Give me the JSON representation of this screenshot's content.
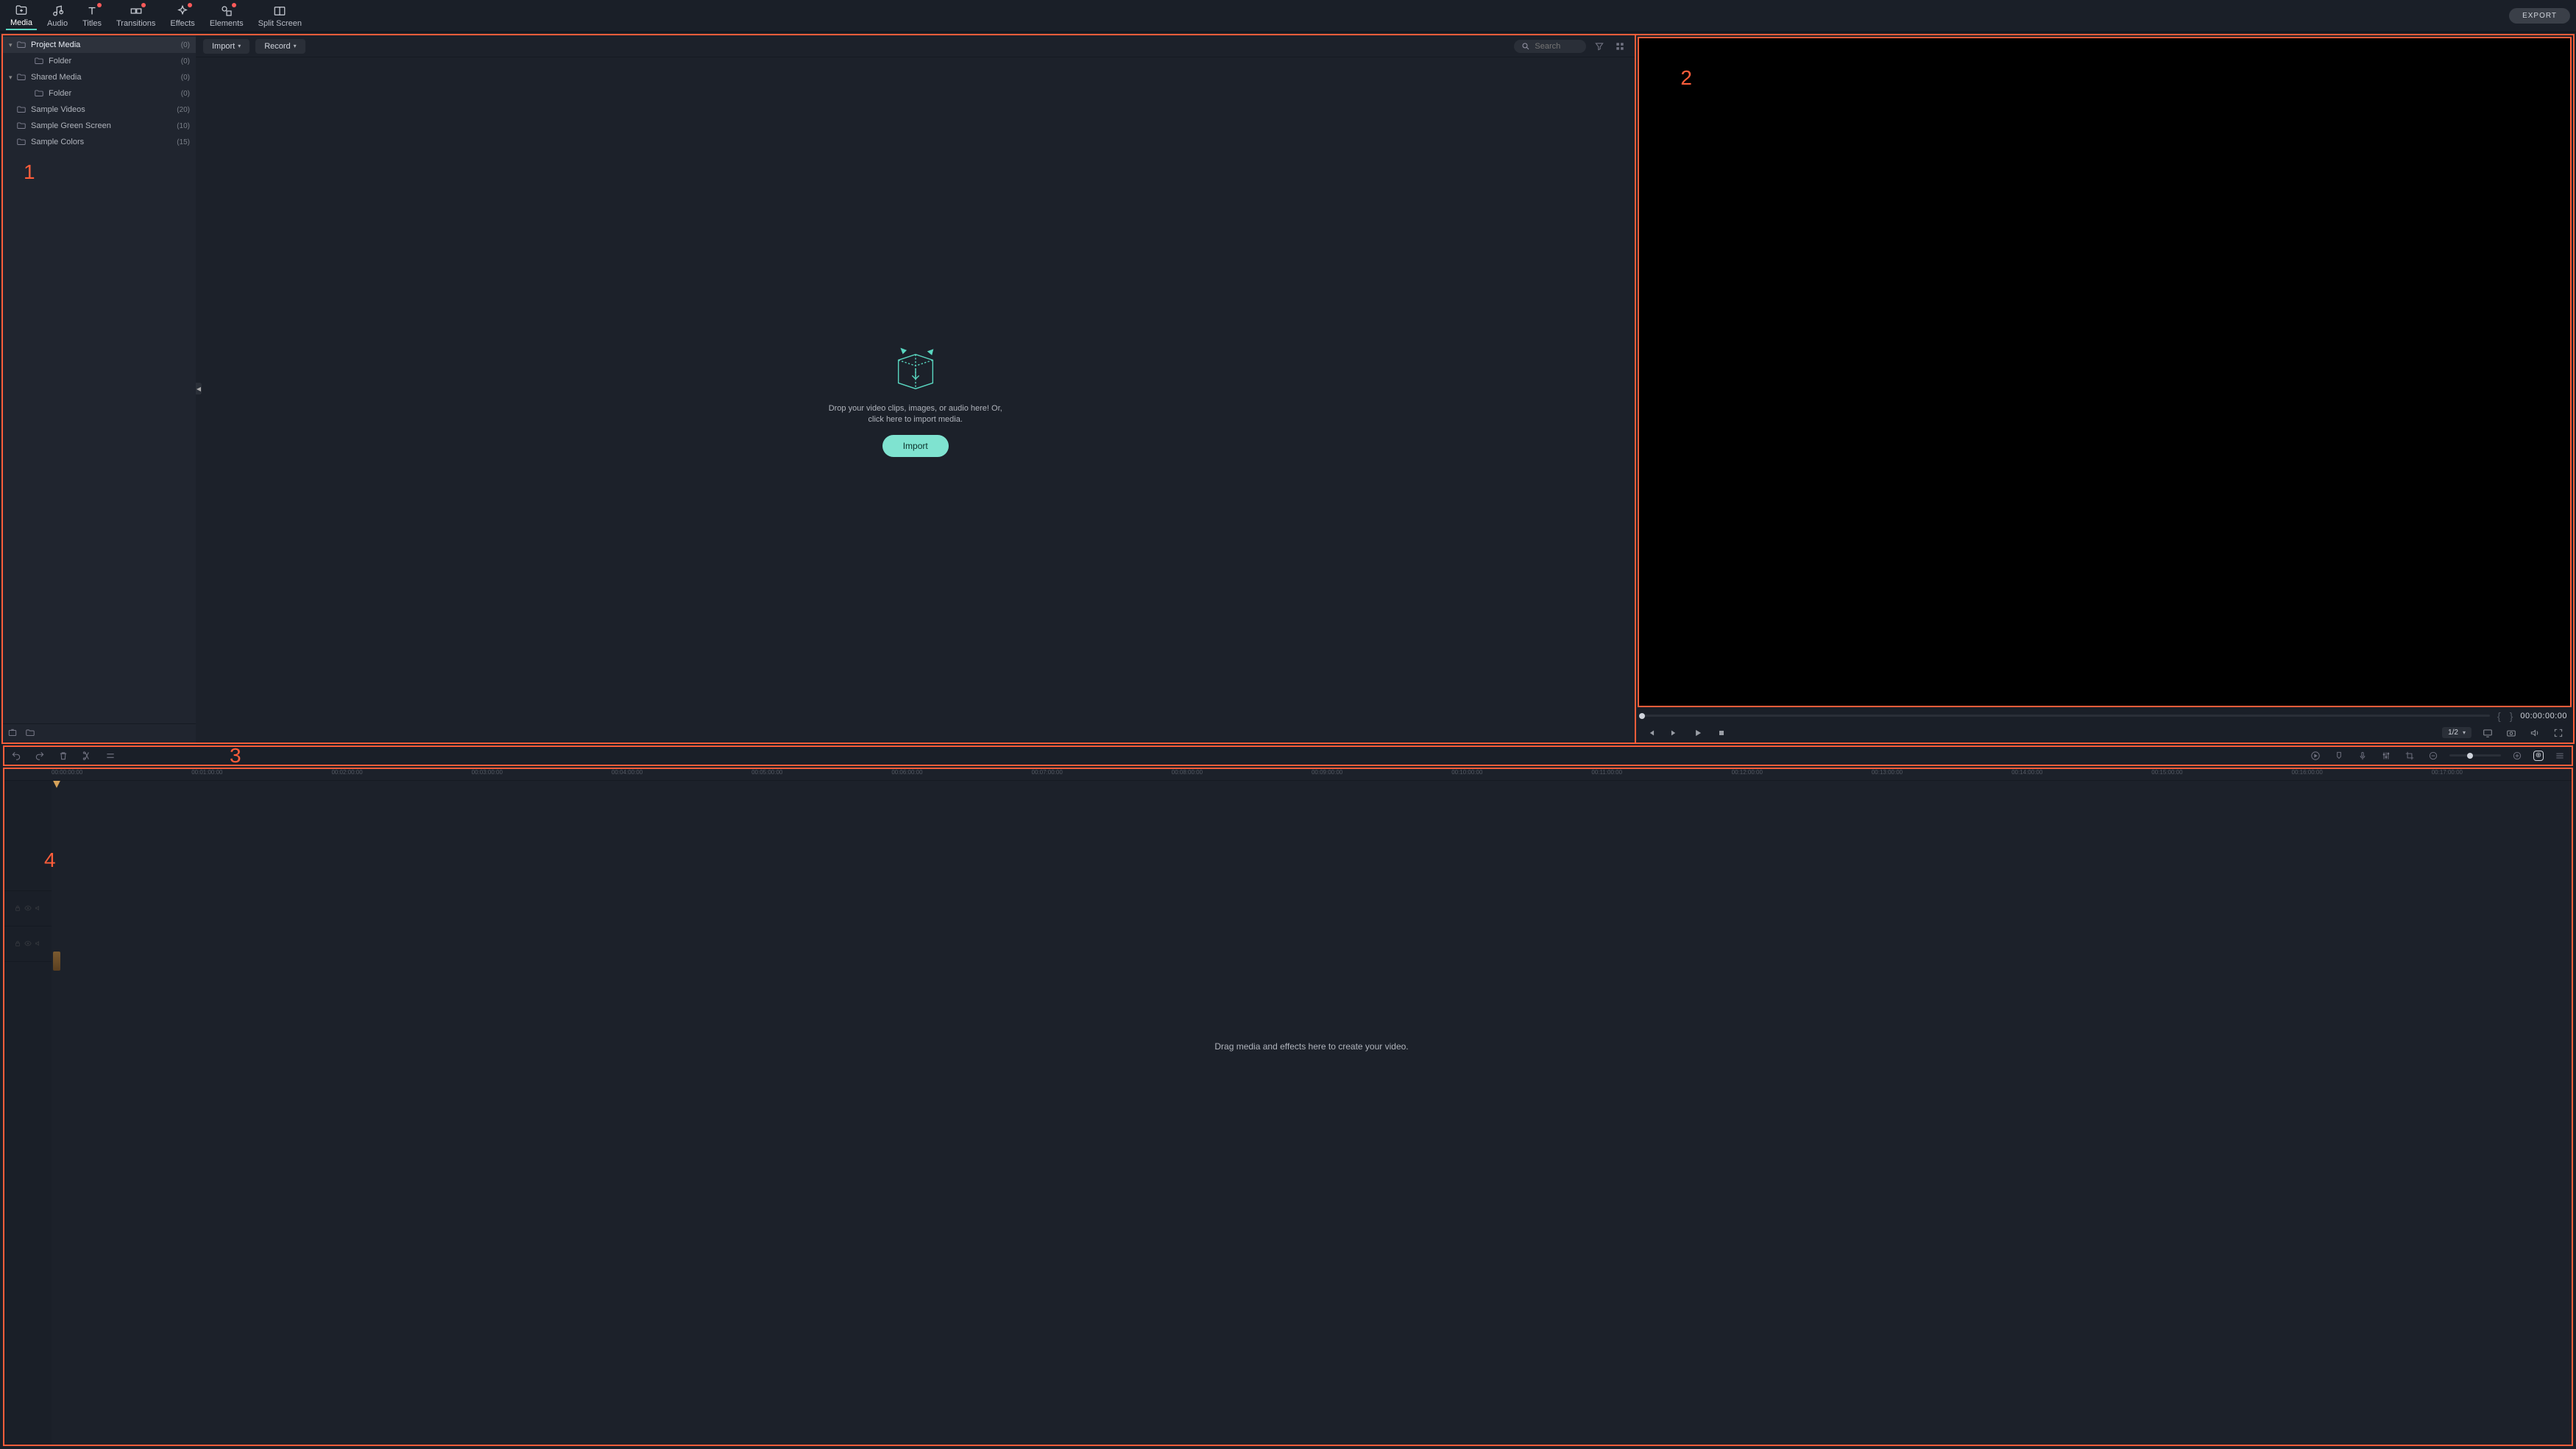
{
  "tabs": [
    {
      "label": "Media",
      "active": true,
      "badge": false
    },
    {
      "label": "Audio",
      "active": false,
      "badge": false
    },
    {
      "label": "Titles",
      "active": false,
      "badge": true
    },
    {
      "label": "Transitions",
      "active": false,
      "badge": true
    },
    {
      "label": "Effects",
      "active": false,
      "badge": true
    },
    {
      "label": "Elements",
      "active": false,
      "badge": true
    },
    {
      "label": "Split Screen",
      "active": false,
      "badge": false
    }
  ],
  "export_label": "EXPORT",
  "sidebar": {
    "tree": [
      {
        "label": "Project Media",
        "count": "(0)",
        "indent": 0,
        "arrow": "▾",
        "selected": true
      },
      {
        "label": "Folder",
        "count": "(0)",
        "indent": 1,
        "arrow": "",
        "selected": false
      },
      {
        "label": "Shared Media",
        "count": "(0)",
        "indent": 0,
        "arrow": "▾",
        "selected": false
      },
      {
        "label": "Folder",
        "count": "(0)",
        "indent": 1,
        "arrow": "",
        "selected": false
      },
      {
        "label": "Sample Videos",
        "count": "(20)",
        "indent": 0,
        "arrow": "",
        "selected": false
      },
      {
        "label": "Sample Green Screen",
        "count": "(10)",
        "indent": 0,
        "arrow": "",
        "selected": false
      },
      {
        "label": "Sample Colors",
        "count": "(15)",
        "indent": 0,
        "arrow": "",
        "selected": false
      }
    ]
  },
  "media_toolbar": {
    "import_label": "Import",
    "record_label": "Record",
    "search_placeholder": "Search"
  },
  "drop_zone": {
    "text": "Drop your video clips, images, or audio here! Or, click here to import media.",
    "button": "Import"
  },
  "preview": {
    "zoom": "1/2",
    "timecode": "00:00:00:00"
  },
  "timeline": {
    "hint": "Drag media and effects here to create your video.",
    "ruler": [
      "00:00:00:00",
      "00:01:00:00",
      "00:02:00:00",
      "00:03:00:00",
      "00:04:00:00",
      "00:05:00:00",
      "00:06:00:00",
      "00:07:00:00",
      "00:08:00:00",
      "00:09:00:00",
      "00:10:00:00",
      "00:11:00:00",
      "00:12:00:00",
      "00:13:00:00",
      "00:14:00:00",
      "00:15:00:00",
      "00:16:00:00",
      "00:17:00:00"
    ]
  },
  "annotations": {
    "a1": "1",
    "a2": "2",
    "a3": "3",
    "a4": "4"
  }
}
